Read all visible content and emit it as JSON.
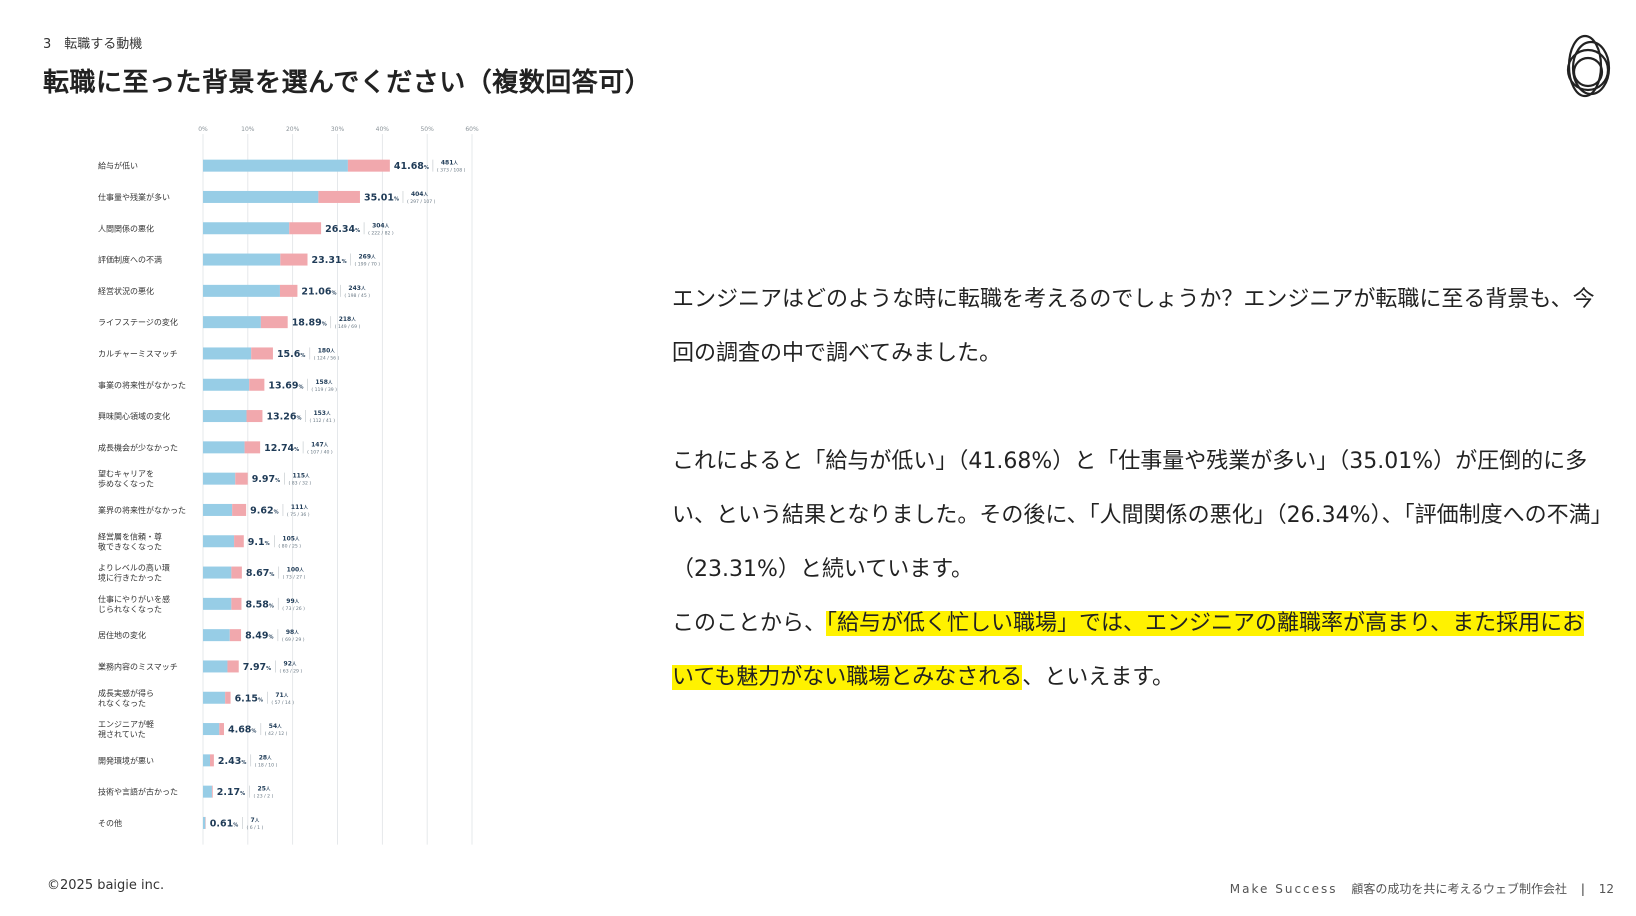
{
  "header": {
    "section": "3　転職する動機",
    "title": "転職に至った背景を選んでください（複数回答可）"
  },
  "chart_data": {
    "type": "bar",
    "orientation": "horizontal",
    "stacked": true,
    "xlim": [
      0,
      60
    ],
    "x_ticks": [
      "0%",
      "10%",
      "20%",
      "30%",
      "40%",
      "50%",
      "60%"
    ],
    "colors": {
      "primary": "#97cde6",
      "secondary": "#f1a8ad",
      "value_text": "#1f3b57"
    },
    "categories": [
      "給与が低い",
      "仕事量や残業が多い",
      "人間関係の悪化",
      "評価制度への不満",
      "経営状況の悪化",
      "ライフステージの変化",
      "カルチャーミスマッチ",
      "事業の将来性がなかった",
      "興味関心領域の変化",
      "成長機会が少なかった",
      "望むキャリアを歩めなくなった",
      "業界の将来性がなかった",
      "経営層を信頼・尊敬できなくなった",
      "よりレベルの高い環境に行きたかった",
      "仕事にやりがいを感じられなくなった",
      "居住地の変化",
      "業務内容のミスマッチ",
      "成長実感が得られなくなった",
      "エンジニアが軽視されていた",
      "開発環境が悪い",
      "技術や言語が古かった",
      "その他"
    ],
    "values": [
      41.68,
      35.01,
      26.34,
      23.31,
      21.06,
      18.89,
      15.6,
      13.69,
      13.26,
      12.74,
      9.97,
      9.62,
      9.1,
      8.67,
      8.58,
      8.49,
      7.97,
      6.15,
      4.68,
      2.43,
      2.17,
      0.61
    ],
    "value_labels": [
      "41.68",
      "35.01",
      "26.34",
      "23.31",
      "21.06",
      "18.89",
      "15.6",
      "13.69",
      "13.26",
      "12.74",
      "9.97",
      "9.62",
      "9.1",
      "8.67",
      "8.58",
      "8.49",
      "7.97",
      "6.15",
      "4.68",
      "2.43",
      "2.17",
      "0.61"
    ],
    "counts": [
      481,
      404,
      304,
      269,
      243,
      218,
      180,
      158,
      153,
      147,
      115,
      111,
      105,
      100,
      99,
      98,
      92,
      71,
      54,
      28,
      25,
      7
    ],
    "breakdown": [
      [
        373,
        108
      ],
      [
        297,
        107
      ],
      [
        222,
        82
      ],
      [
        199,
        70
      ],
      [
        198,
        45
      ],
      [
        149,
        69
      ],
      [
        124,
        56
      ],
      [
        119,
        39
      ],
      [
        112,
        41
      ],
      [
        107,
        40
      ],
      [
        83,
        32
      ],
      [
        75,
        36
      ],
      [
        80,
        25
      ],
      [
        73,
        27
      ],
      [
        73,
        26
      ],
      [
        69,
        29
      ],
      [
        63,
        29
      ],
      [
        57,
        14
      ],
      [
        42,
        12
      ],
      [
        18,
        10
      ],
      [
        23,
        2
      ],
      [
        6,
        1
      ]
    ],
    "percent_unit": "%",
    "count_unit": "人"
  },
  "body": {
    "p1": "エンジニアはどのような時に転職を考えるのでしょうか？エンジニアが転職に至る背景も、今回の調査の中で調べてみました。",
    "p2": "これによると「給与が低い」（41.68%）と「仕事量や残業が多い」（35.01%）が圧倒的に多い、という結果となりました。その後に、「人間関係の悪化」（26.34%）、「評価制度への不満」（23.31%）と続いています。",
    "p3_before": "このことから、",
    "p3_highlight": "「給与が低く忙しい職場」では、エンジニアの離職率が高まり、また採用においても魅力がない職場とみなされる",
    "p3_after": "、といえます。",
    "highlight_color": "#fff200"
  },
  "footer": {
    "copyright": "©2025 baigie inc.",
    "tagline": "Make Success",
    "company_desc": "顧客の成功を共に考えるウェブ制作会社",
    "separator": "|",
    "page_number": "12"
  }
}
